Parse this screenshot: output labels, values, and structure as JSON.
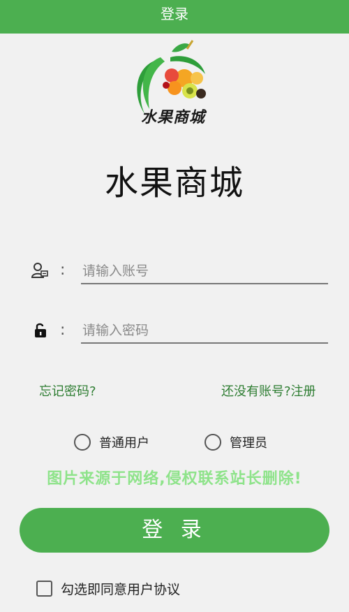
{
  "topbar": {
    "title": "登录"
  },
  "logo": {
    "text": "水果商城"
  },
  "app": {
    "title": "水果商城"
  },
  "form": {
    "account": {
      "colon": ":",
      "placeholder": "请输入账号",
      "value": ""
    },
    "password": {
      "colon": ":",
      "placeholder": "请输入密码",
      "value": ""
    }
  },
  "links": {
    "forgot": "忘记密码?",
    "register": "还没有账号?注册"
  },
  "roles": [
    {
      "label": "普通用户",
      "selected": false
    },
    {
      "label": "管理员",
      "selected": false
    }
  ],
  "watermark": "图片来源于网络,侵权联系站长删除!",
  "login_button": "登 录",
  "agreement": {
    "label": "勾选即同意用户协议",
    "checked": false
  },
  "colors": {
    "primary": "#4caf50",
    "link": "#2e7d32",
    "watermark": "#8ee38a",
    "background": "#f1f1f1"
  },
  "icons": {
    "account": "user-icon",
    "password": "lock-icon"
  }
}
